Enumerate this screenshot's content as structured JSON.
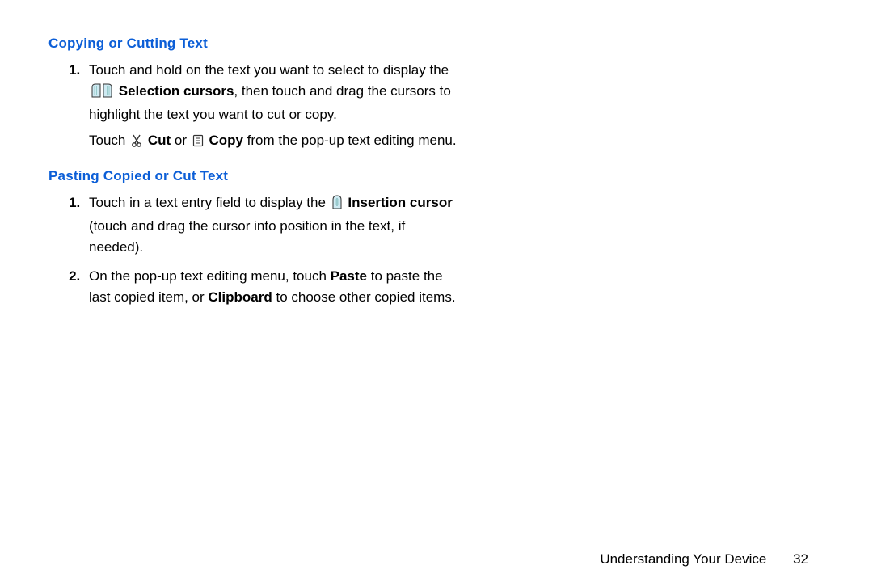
{
  "section1": {
    "heading": "Copying or Cutting Text",
    "item1": {
      "text_a": "Touch and hold on the text you want to select to display the ",
      "bold_a": "Selection cursors",
      "text_b": ", then touch and drag the cursors to highlight the text you want to cut or copy.",
      "text_c": "Touch ",
      "bold_b": "Cut",
      "text_d": " or ",
      "bold_c": "Copy",
      "text_e": " from the pop-up text editing menu."
    }
  },
  "section2": {
    "heading": "Pasting Copied or Cut Text",
    "item1": {
      "text_a": "Touch in a text entry field to display the ",
      "bold_a": "Insertion cursor",
      "text_b": " (touch and drag the cursor into position in the text, if needed)."
    },
    "item2": {
      "text_a": "On the pop-up text editing menu, touch ",
      "bold_a": "Paste",
      "text_b": " to paste the last copied item, or ",
      "bold_b": "Clipboard",
      "text_c": " to choose other copied items."
    }
  },
  "footer": {
    "label": "Understanding Your Device",
    "page": "32"
  }
}
